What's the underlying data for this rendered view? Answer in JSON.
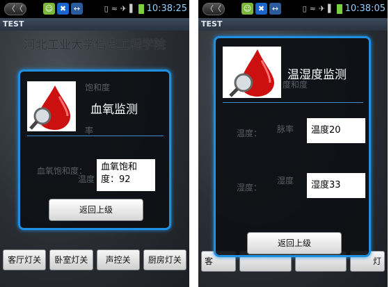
{
  "left": {
    "status": {
      "time": "10:38:25"
    },
    "app_title": "TEST",
    "bg_title": "河北工业大学信息工程学院",
    "bg_buttons": [
      "客厅灯关",
      "卧室灯关",
      "声控关",
      "厨房灯关"
    ],
    "dialog": {
      "title": "血氧监测",
      "value": "血氧饱和度：92",
      "back_label": "返回上级",
      "ghost_labels": [
        "饱和度",
        "率",
        "血氧饱和度：",
        "温度"
      ]
    }
  },
  "right": {
    "status": {
      "time": "10:38:05"
    },
    "app_title": "TEST",
    "bg_buttons": [
      "客",
      "灯"
    ],
    "dialog": {
      "title": "温湿度监测",
      "value_temp": "温度20",
      "value_humidity": "湿度33",
      "back_label": "返回上级",
      "ghost_labels": [
        "度和度",
        "温度：",
        "脉率",
        "湿度：",
        "湿度"
      ]
    }
  },
  "colors": {
    "accent": "#1f8fe0",
    "blood": "#cc1010"
  }
}
